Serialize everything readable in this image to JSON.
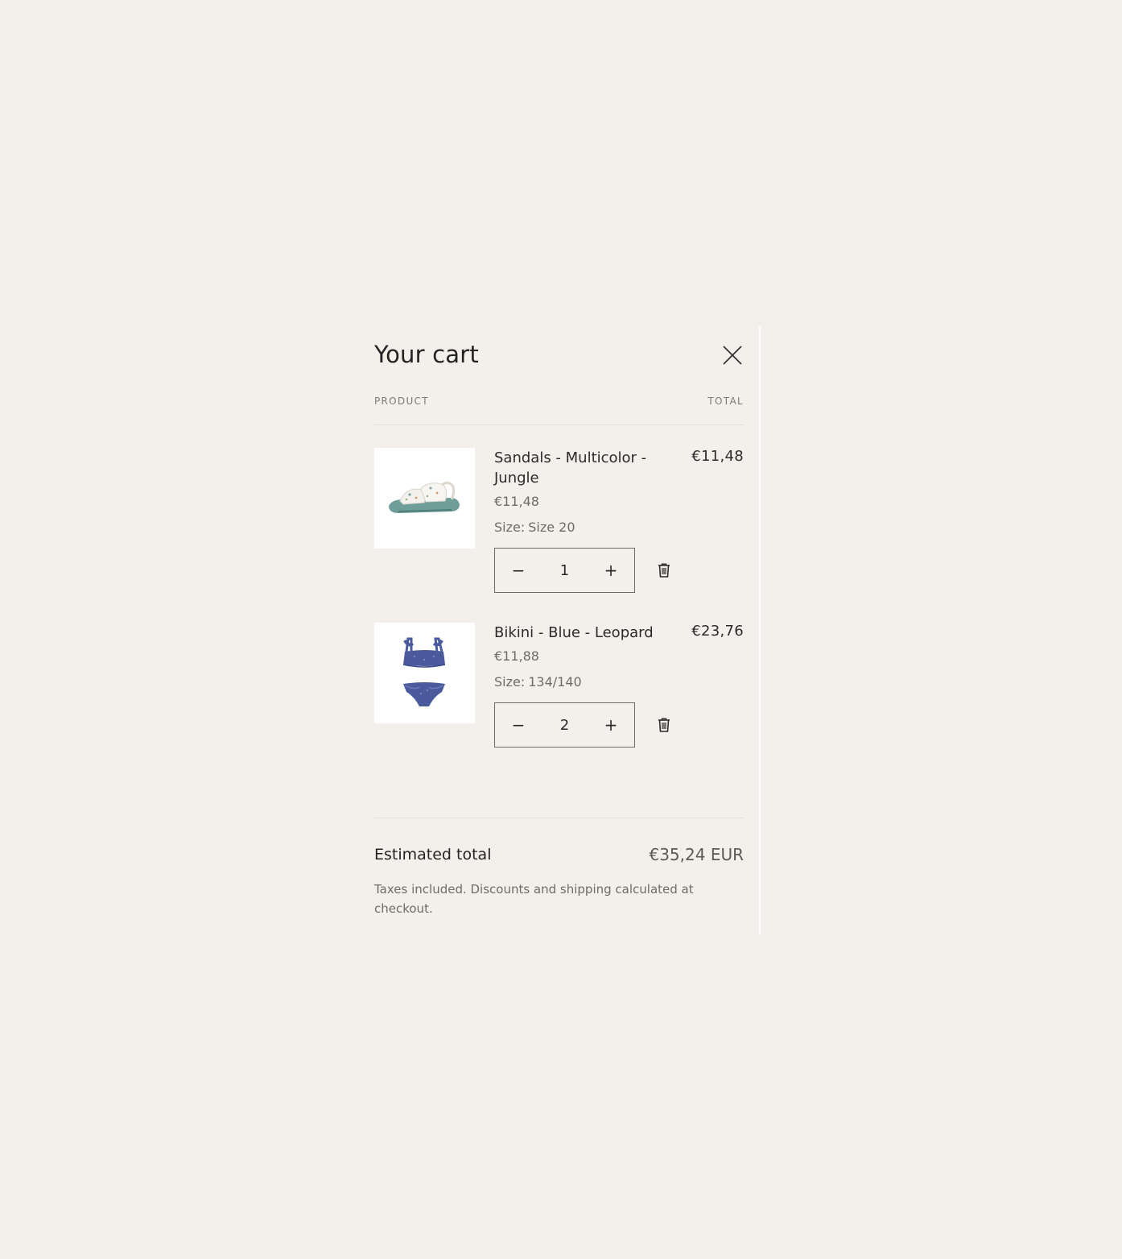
{
  "cart": {
    "title": "Your cart",
    "close_label": "Close",
    "columns": {
      "product": "PRODUCT",
      "total": "TOTAL"
    },
    "items": [
      {
        "name": "Sandals - Multicolor - Jungle",
        "unit_price": "€11,48",
        "size_label": "Size:",
        "size_value": "Size 20",
        "quantity": "1",
        "line_total": "€11,48",
        "image_icon": "sandal-image"
      },
      {
        "name": "Bikini - Blue - Leopard",
        "unit_price": "€11,88",
        "size_label": "Size:",
        "size_value": "134/140",
        "quantity": "2",
        "line_total": "€23,76",
        "image_icon": "bikini-image"
      }
    ],
    "qty_minus": "−",
    "qty_plus": "+",
    "estimated_total_label": "Estimated total",
    "estimated_total_value": "€35,24 EUR",
    "tax_note": "Taxes included. Discounts and shipping calculated at checkout."
  },
  "colors": {
    "background": "#f3f0eb",
    "text": "#2b2b2b",
    "muted": "#6f6b66",
    "sandal_sole": "#6f9e9a",
    "bikini_blue": "#4a5a9c"
  }
}
